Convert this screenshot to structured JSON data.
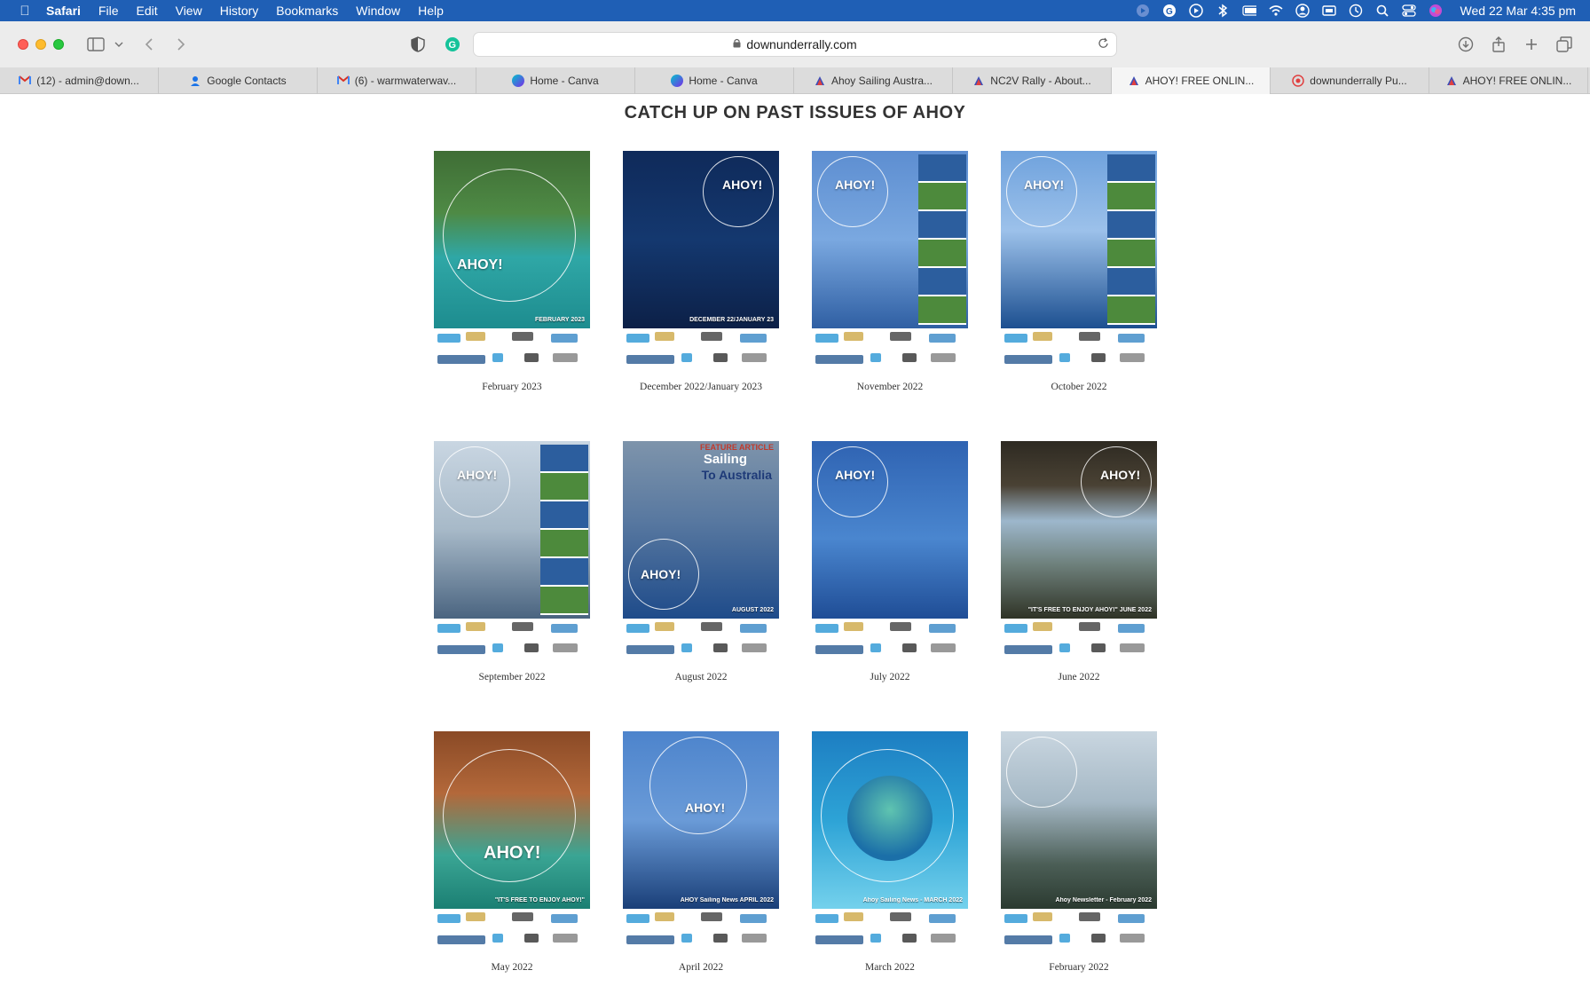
{
  "menubar": {
    "app_name": "Safari",
    "items": [
      "File",
      "Edit",
      "View",
      "History",
      "Bookmarks",
      "Window",
      "Help"
    ],
    "clock": "Wed 22 Mar  4:35 pm"
  },
  "toolbar": {
    "url": "downunderrally.com"
  },
  "tabs": [
    {
      "label": "(12) - admin@down...",
      "favicon": "gmail-icon",
      "color": "#d93025"
    },
    {
      "label": "Google Contacts",
      "favicon": "contacts-icon",
      "color": "#1a73e8"
    },
    {
      "label": "(6) - warmwaterwav...",
      "favicon": "gmail-icon",
      "color": "#d93025"
    },
    {
      "label": "Home - Canva",
      "favicon": "canva-icon",
      "color": "#7d2ae8"
    },
    {
      "label": "Home - Canva",
      "favicon": "canva-icon",
      "color": "#7d2ae8"
    },
    {
      "label": "Ahoy Sailing Austra...",
      "favicon": "ahoy-icon",
      "color": "#3b4fb8"
    },
    {
      "label": "NC2V Rally - About...",
      "favicon": "ahoy-icon",
      "color": "#3b4fb8"
    },
    {
      "label": "AHOY! FREE ONLIN...",
      "favicon": "ahoy-icon",
      "color": "#3b4fb8",
      "active": true
    },
    {
      "label": "downunderrally Pu...",
      "favicon": "target-icon",
      "color": "#e04040"
    },
    {
      "label": "AHOY! FREE ONLIN...",
      "favicon": "ahoy-icon",
      "color": "#3b4fb8"
    }
  ],
  "page": {
    "heading": "CATCH UP ON PAST ISSUES OF AHOY",
    "issues": [
      {
        "caption": "February 2023",
        "style": "islands",
        "cover_text": "AHOY!",
        "date_text": "FEBRUARY 2023"
      },
      {
        "caption": "December 2022/January 2023",
        "style": "mast",
        "cover_text": "AHOY!",
        "date_text": "DECEMBER 22/JANUARY 23"
      },
      {
        "caption": "November 2022",
        "style": "sail",
        "cover_text": "AHOY!",
        "date_text": ""
      },
      {
        "caption": "October 2022",
        "style": "catamaran",
        "cover_text": "AHOY!",
        "date_text": ""
      },
      {
        "caption": "September 2022",
        "style": "redsail",
        "cover_text": "AHOY!",
        "date_text": ""
      },
      {
        "caption": "August 2022",
        "style": "bird",
        "cover_text": "AHOY!",
        "date_text": "AUGUST 2022",
        "feature_line1": "FEATURE ARTICLE",
        "feature_line2": "Sailing",
        "feature_line3": "To Australia"
      },
      {
        "caption": "July 2022",
        "style": "tower",
        "cover_text": "AHOY!",
        "date_text": ""
      },
      {
        "caption": "June 2022",
        "style": "cave",
        "cover_text": "AHOY!",
        "date_text": "\"IT'S FREE TO ENJOY AHOY!\"  JUNE 2022"
      },
      {
        "caption": "May 2022",
        "style": "gorge",
        "cover_text": "AHOY!",
        "date_text": "\"IT'S FREE TO ENJOY AHOY!\""
      },
      {
        "caption": "April 2022",
        "style": "wreck",
        "cover_text": "AHOY!",
        "date_text": "AHOY Sailing News  APRIL 2022"
      },
      {
        "caption": "March 2022",
        "style": "lagoon",
        "cover_text": "",
        "date_text": "Ahoy Sailing News - MARCH 2022"
      },
      {
        "caption": "February 2022",
        "style": "jetty",
        "cover_text": "",
        "date_text": "Ahoy Newsletter - February 2022"
      }
    ]
  }
}
